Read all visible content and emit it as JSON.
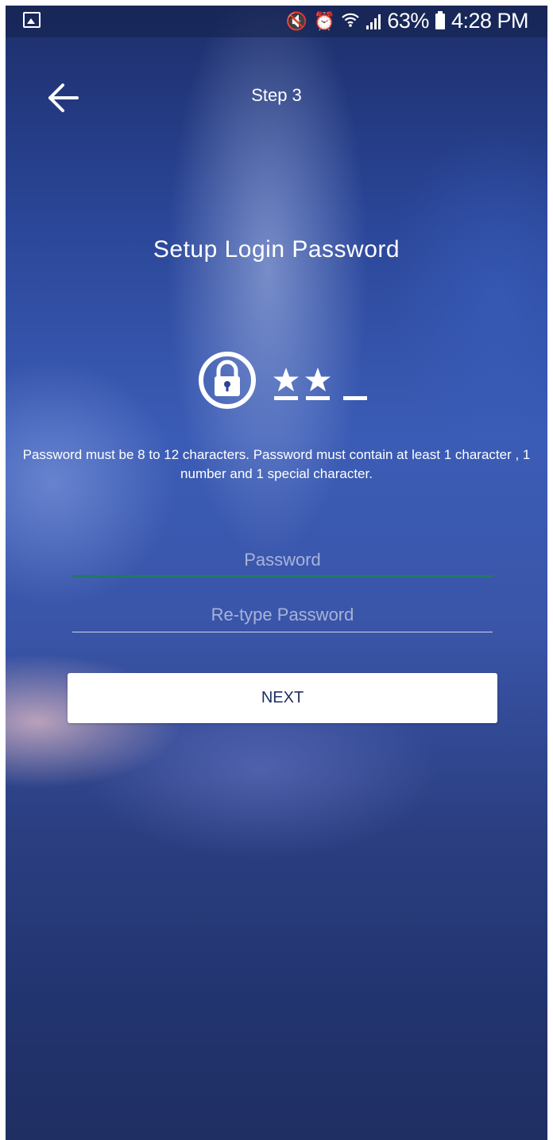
{
  "status_bar": {
    "battery": "63%",
    "time": "4:28 PM"
  },
  "header": {
    "step": "Step 3"
  },
  "main": {
    "title": "Setup Login Password",
    "rules": "Password must be 8 to 12 characters. Password must contain at least 1 character , 1 number and 1 special character.",
    "password_placeholder": "Password",
    "retype_placeholder": "Re-type Password",
    "next_label": "NEXT"
  },
  "colors": {
    "accent_underline": "#1f7a62",
    "button_text": "#1f2f63"
  },
  "icons": [
    "gallery-icon",
    "mute-icon",
    "alarm-icon",
    "wifi-icon",
    "signal-icon",
    "battery-icon",
    "back-arrow-icon",
    "lock-icon"
  ]
}
